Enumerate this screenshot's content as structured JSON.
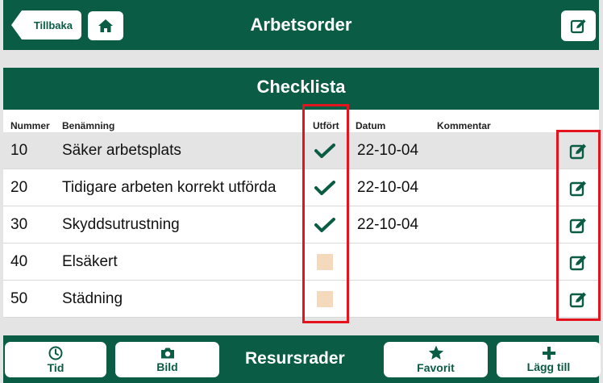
{
  "header": {
    "title": "Arbetsorder",
    "back_label": "Tillbaka"
  },
  "section": {
    "title": "Checklista"
  },
  "table": {
    "columns": {
      "number": "Nummer",
      "name": "Benämning",
      "done": "Utfört",
      "date": "Datum",
      "comment": "Kommentar"
    },
    "rows": [
      {
        "number": "10",
        "name": "Säker arbetsplats",
        "done": true,
        "date": "22-10-04",
        "comment": ""
      },
      {
        "number": "20",
        "name": "Tidigare arbeten korrekt utförda",
        "done": true,
        "date": "22-10-04",
        "comment": ""
      },
      {
        "number": "30",
        "name": "Skyddsutrustning",
        "done": true,
        "date": "22-10-04",
        "comment": ""
      },
      {
        "number": "40",
        "name": "Elsäkert",
        "done": false,
        "date": "",
        "comment": ""
      },
      {
        "number": "50",
        "name": "Städning",
        "done": false,
        "date": "",
        "comment": ""
      }
    ]
  },
  "bottom": {
    "title": "Resursrader",
    "time_label": "Tid",
    "image_label": "Bild",
    "favorite_label": "Favorit",
    "add_label": "Lägg till"
  },
  "icons": {
    "home": "home-icon",
    "edit": "edit-icon",
    "check": "check-icon",
    "clock": "clock-icon",
    "camera": "camera-icon",
    "star": "star-icon",
    "plus": "plus-icon"
  },
  "colors": {
    "brand": "#0b5c45",
    "unchecked_box": "#f5d9bc",
    "highlight": "#e3141e"
  }
}
